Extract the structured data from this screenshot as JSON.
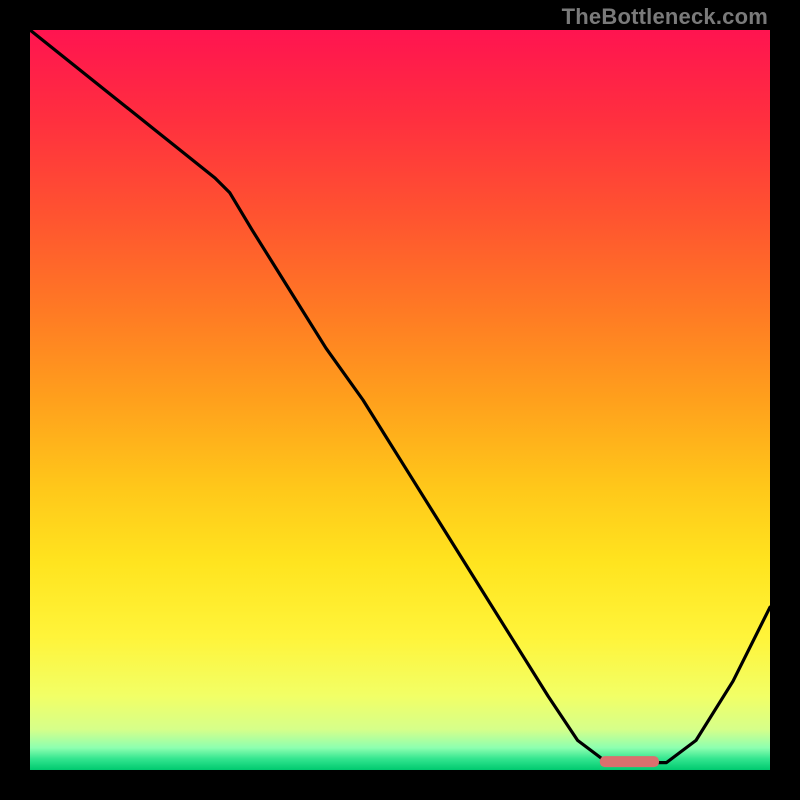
{
  "watermark": "TheBottleneck.com",
  "chart_data": {
    "type": "line",
    "title": "",
    "xlabel": "",
    "ylabel": "",
    "xlim": [
      0,
      100
    ],
    "ylim": [
      0,
      100
    ],
    "grid": false,
    "series": [
      {
        "name": "curve",
        "x": [
          0,
          5,
          10,
          15,
          20,
          25,
          27,
          30,
          35,
          40,
          45,
          50,
          55,
          60,
          65,
          70,
          74,
          78,
          82,
          86,
          90,
          95,
          100
        ],
        "y": [
          100,
          96,
          92,
          88,
          84,
          80,
          78,
          73,
          65,
          57,
          50,
          42,
          34,
          26,
          18,
          10,
          4,
          1,
          1,
          1,
          4,
          12,
          22
        ]
      }
    ],
    "marker": {
      "name": "highlight-segment",
      "x_start": 77,
      "x_end": 85,
      "y": 1.2,
      "color": "#d9706e"
    },
    "gradient_stops": [
      {
        "offset": 0.0,
        "color": "#ff1450"
      },
      {
        "offset": 0.12,
        "color": "#ff2f3f"
      },
      {
        "offset": 0.25,
        "color": "#ff5330"
      },
      {
        "offset": 0.38,
        "color": "#ff7a24"
      },
      {
        "offset": 0.5,
        "color": "#ffa01c"
      },
      {
        "offset": 0.62,
        "color": "#ffc81a"
      },
      {
        "offset": 0.72,
        "color": "#ffe41f"
      },
      {
        "offset": 0.82,
        "color": "#fff43a"
      },
      {
        "offset": 0.9,
        "color": "#f2ff66"
      },
      {
        "offset": 0.945,
        "color": "#d6ff8a"
      },
      {
        "offset": 0.97,
        "color": "#8dffb0"
      },
      {
        "offset": 0.985,
        "color": "#33e58f"
      },
      {
        "offset": 1.0,
        "color": "#00c96f"
      }
    ]
  }
}
